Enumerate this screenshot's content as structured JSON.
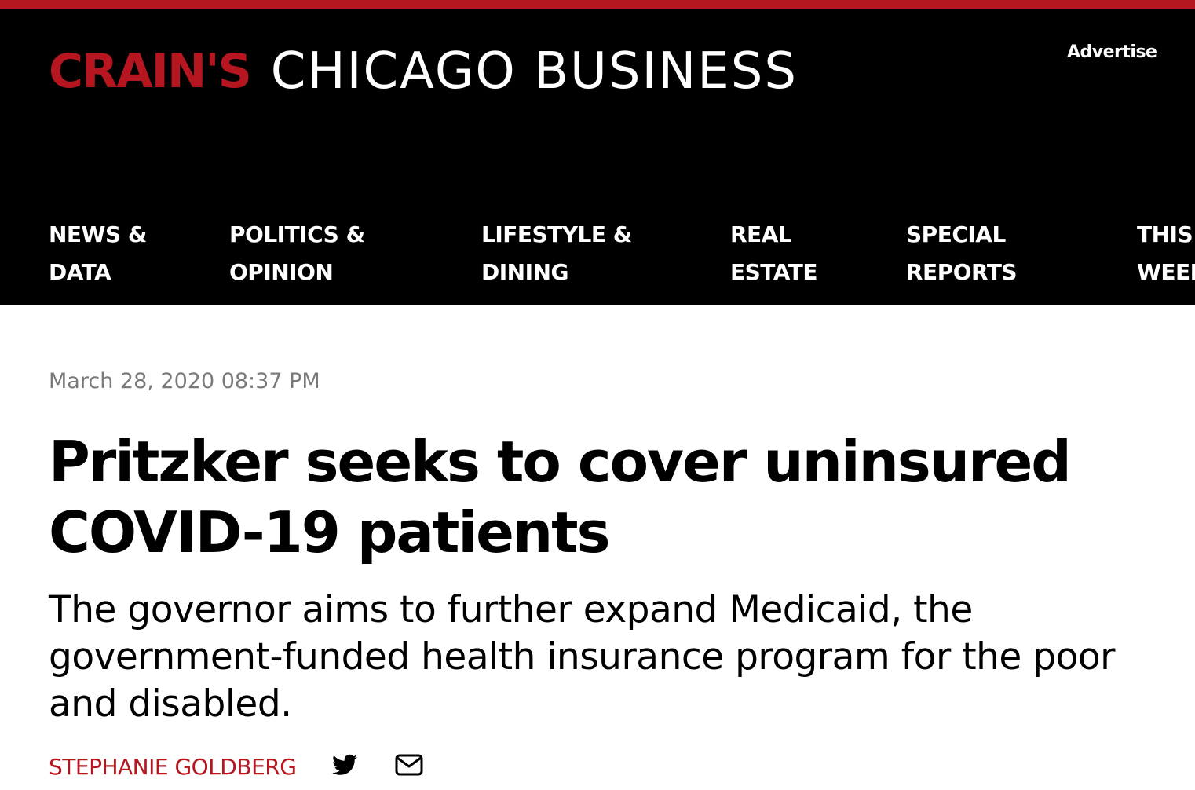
{
  "colors": {
    "accent_red": "#b5161f",
    "header_bg": "#000000",
    "date_gray": "#7a7a7a"
  },
  "header": {
    "brand": "CRAIN'S",
    "city": "CHICAGO BUSINESS",
    "advertise_label": "Advertise"
  },
  "nav": {
    "items": [
      {
        "line1": "NEWS &",
        "line2": "DATA"
      },
      {
        "line1": "POLITICS &",
        "line2": "OPINION"
      },
      {
        "line1": "LIFESTYLE &",
        "line2": "DINING"
      },
      {
        "line1": "REAL",
        "line2": "ESTATE"
      },
      {
        "line1": "SPECIAL",
        "line2": "REPORTS"
      },
      {
        "line1": "THIS",
        "line2": "WEEK"
      }
    ]
  },
  "article": {
    "date": "March 28, 2020 08:37 PM",
    "headline": "Pritzker seeks to cover uninsured COVID-19 patients",
    "subhead": "The governor aims to further expand Medicaid, the government-funded health insurance program for the poor and disabled.",
    "author": "STEPHANIE GOLDBERG"
  },
  "icons": {
    "twitter": "twitter-icon",
    "email": "email-icon"
  }
}
